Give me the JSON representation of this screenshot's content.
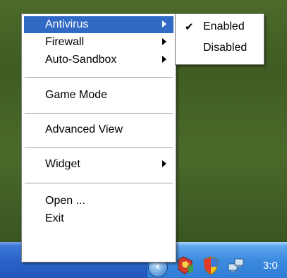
{
  "context_menu": {
    "items": [
      {
        "label": "Antivirus",
        "has_submenu": true,
        "highlighted": true
      },
      {
        "label": "Firewall",
        "has_submenu": true
      },
      {
        "label": "Auto-Sandbox",
        "has_submenu": true
      },
      {
        "label": "Game Mode",
        "has_submenu": false
      },
      {
        "label": "Advanced View",
        "has_submenu": false
      },
      {
        "label": "Widget",
        "has_submenu": true
      },
      {
        "label": "Open ...",
        "has_submenu": false
      },
      {
        "label": "Exit",
        "has_submenu": false
      }
    ]
  },
  "submenu": {
    "items": [
      {
        "label": "Enabled",
        "checked": true
      },
      {
        "label": "Disabled",
        "checked": false
      }
    ]
  },
  "taskbar": {
    "clock": "3:0",
    "tray_icons": [
      "show-hidden-icons-chevron",
      "comodo-tray-icon",
      "security-shield-icon",
      "network-icon"
    ]
  },
  "colors": {
    "selection": "#316ac5",
    "taskbar": "#2a64c9",
    "tray": "#3c8be0",
    "desktop": "#4a6a2a"
  }
}
